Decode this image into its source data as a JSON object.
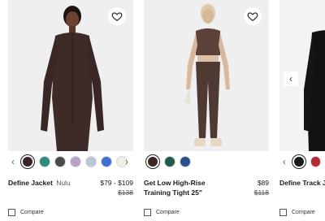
{
  "products": [
    {
      "name": "Define Jacket",
      "subtitle": "Nulu",
      "price": "$79 - $109",
      "was_price": "$138",
      "swatches": [
        "#3b2624",
        "#2e8a7c",
        "#4a4a4a",
        "#b6a1c9",
        "#b9c7d6",
        "#3f6fcf",
        "#efefe7"
      ]
    },
    {
      "name": "Get Low High-Rise Training Tight 25\"",
      "subtitle": "",
      "price": "$89",
      "was_price": "$118",
      "swatches": [
        "#3b2624",
        "#1f5c4a",
        "#2d4f8f"
      ]
    },
    {
      "name": "Define Track Jac",
      "subtitle": "",
      "price": "",
      "was_price": "",
      "swatches": [
        "#1a1a1a",
        "#b52a35",
        "#c9333b"
      ]
    }
  ],
  "compare_label": "Compare",
  "colors": {
    "jacket": "#3e2a27",
    "tank": "#5a4238",
    "black_jacket": "#111111"
  },
  "icons": {
    "favorite": "heart-icon",
    "prev": "chevron-left-icon",
    "next": "chevron-right-icon"
  }
}
